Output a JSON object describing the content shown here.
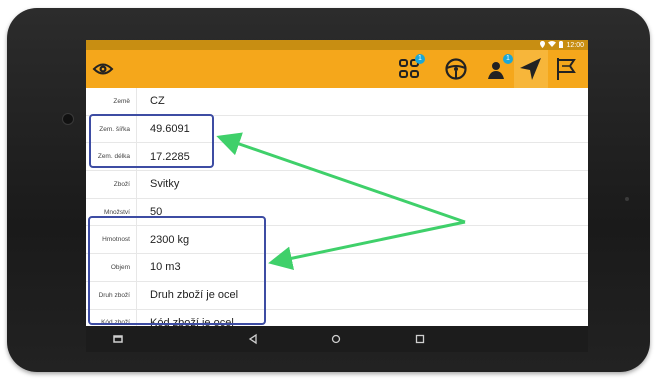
{
  "status_bar": {
    "time": "12:00"
  },
  "toolbar": {
    "badge_count_1": "1",
    "badge_count_2": "1"
  },
  "detail_rows": [
    {
      "label": "Země",
      "value": "CZ"
    },
    {
      "label": "Zem. šířka",
      "value": "49.6091"
    },
    {
      "label": "Zem. délka",
      "value": "17.2285"
    },
    {
      "label": "Zboží",
      "value": "Svitky"
    },
    {
      "label": "Množství",
      "value": "50"
    },
    {
      "label": "Hmotnost",
      "value": "2300 kg"
    },
    {
      "label": "Objem",
      "value": "10 m3"
    },
    {
      "label": "Druh zboží",
      "value": "Druh zboží je ocel"
    },
    {
      "label": "Kód zboží",
      "value": "Kód zboží je ocel"
    }
  ],
  "colors": {
    "accent": "#f5a71b",
    "status_bar": "#c88e12",
    "highlight_box": "#3d4ca3",
    "arrow": "#3fd06a"
  },
  "icons": {
    "app_logo": "eye-logo-icon",
    "tool_1": "grid-dots-icon",
    "tool_2": "steering-wheel-icon",
    "tool_3": "person-notification-icon",
    "tool_4": "navigation-arrow-icon",
    "tool_5": "flag-icon"
  }
}
